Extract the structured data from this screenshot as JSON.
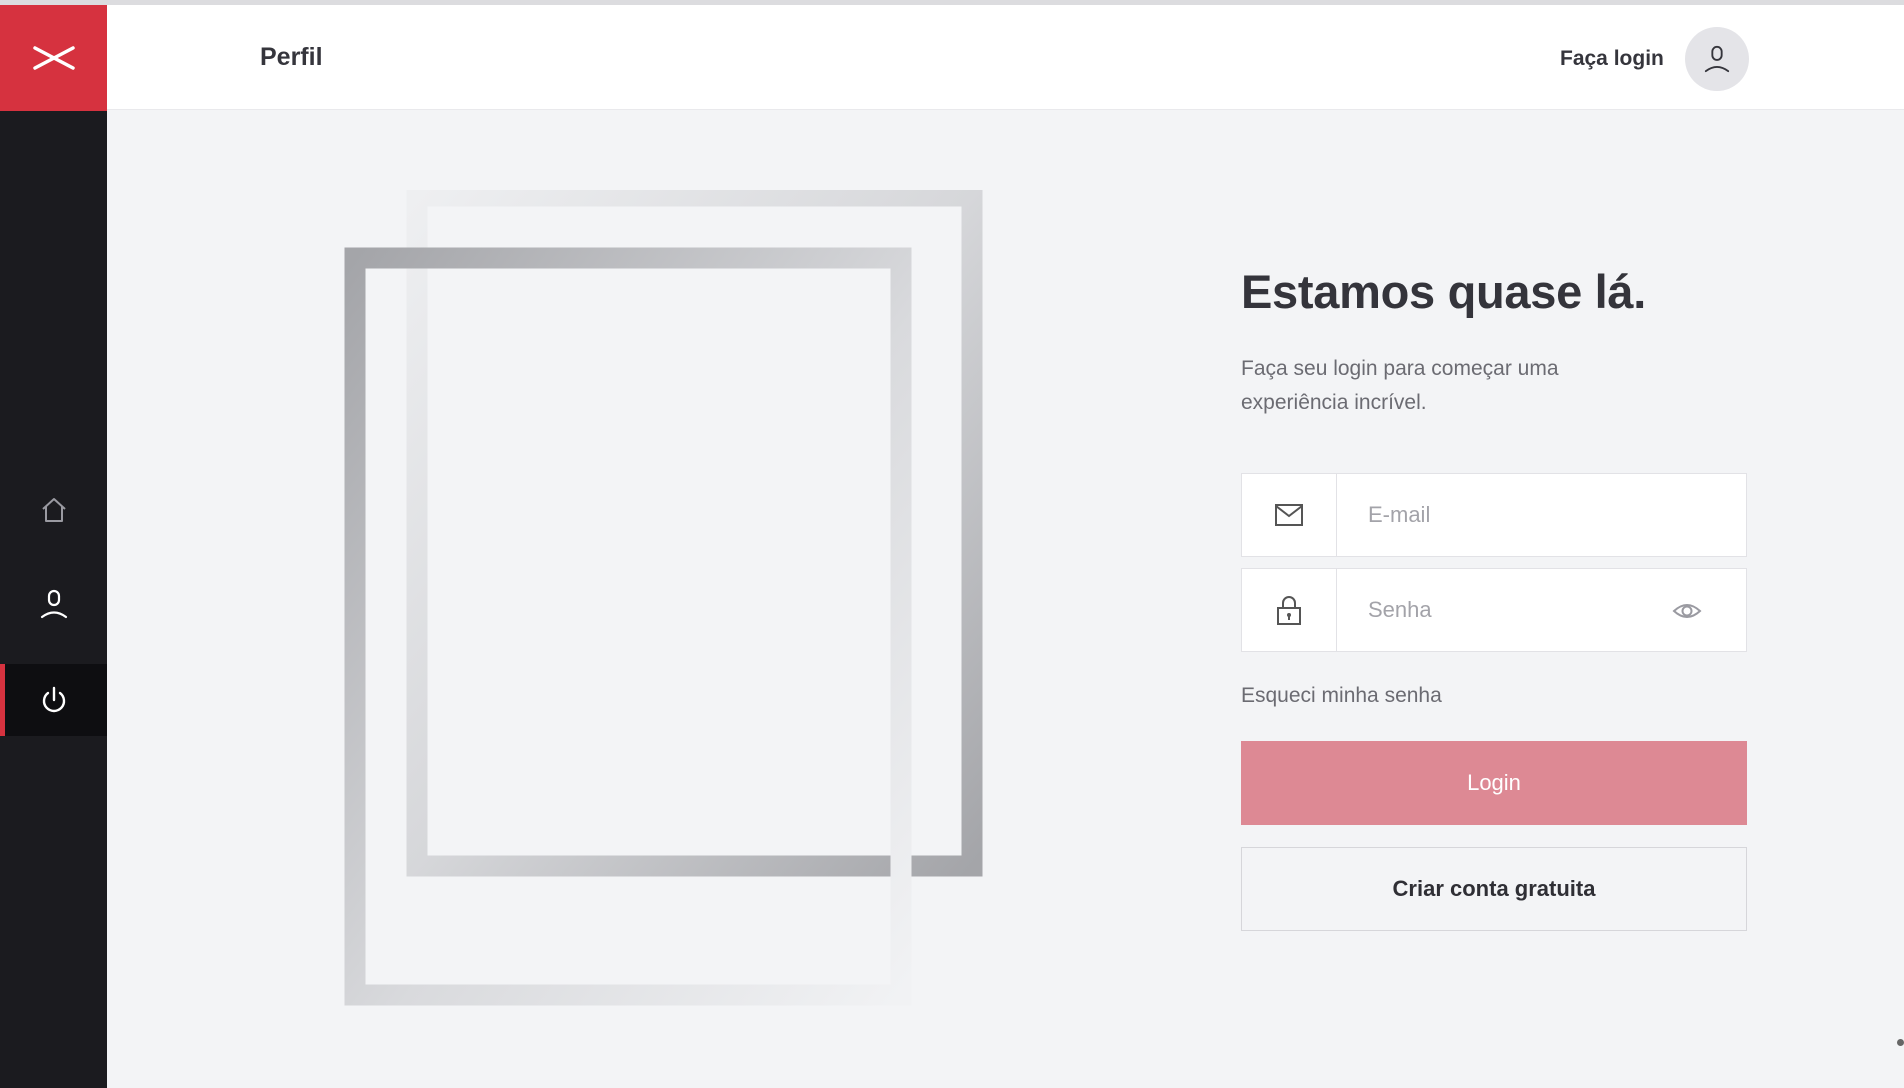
{
  "header": {
    "title": "Perfil",
    "login_link": "Faça login",
    "avatar_icon": "user-icon"
  },
  "sidebar": {
    "logo_icon": "scissors-logo-icon",
    "items": [
      {
        "name": "home",
        "icon": "home-icon"
      },
      {
        "name": "profile",
        "icon": "user-icon"
      },
      {
        "name": "logout",
        "icon": "power-icon",
        "active": true
      }
    ]
  },
  "login": {
    "heading": "Estamos quase lá.",
    "subtext": "Faça seu login para começar uma experiência incrível.",
    "email_placeholder": "E-mail",
    "password_placeholder": "Senha",
    "forgot": "Esqueci minha senha",
    "login_button": "Login",
    "create_button": "Criar conta gratuita"
  },
  "colors": {
    "brand": "#d6323f",
    "sidebar_bg": "#1b1b1f",
    "page_bg": "#f3f4f6",
    "login_button": "#dd8994"
  }
}
